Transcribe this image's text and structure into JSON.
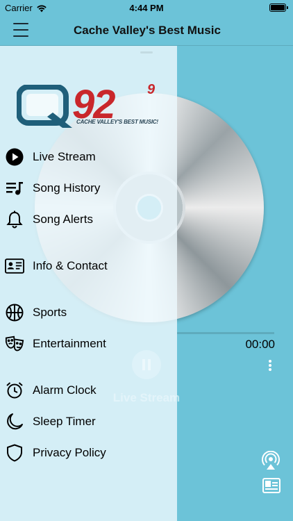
{
  "status_bar": {
    "carrier": "Carrier",
    "time": "4:44 PM"
  },
  "nav": {
    "title": "Cache Valley's Best Music"
  },
  "logo": {
    "brand": "Q92",
    "superscript": "9",
    "tagline": "CACHE VALLEY'S BEST MUSIC!"
  },
  "player": {
    "elapsed": "00:00",
    "stream_label": "Live Stream"
  },
  "menu": {
    "items": [
      {
        "label": "Live Stream",
        "icon": "play-circle-icon"
      },
      {
        "label": "Song History",
        "icon": "music-list-icon"
      },
      {
        "label": "Song Alerts",
        "icon": "bell-icon"
      },
      {
        "label": "Info & Contact",
        "icon": "contact-card-icon"
      },
      {
        "label": "Sports",
        "icon": "basketball-icon"
      },
      {
        "label": "Entertainment",
        "icon": "theater-masks-icon"
      },
      {
        "label": "Alarm Clock",
        "icon": "alarm-clock-icon"
      },
      {
        "label": "Sleep Timer",
        "icon": "moon-icon"
      },
      {
        "label": "Privacy Policy",
        "icon": "shield-icon"
      }
    ]
  },
  "colors": {
    "background": "#6cc3d8",
    "drawer": "#ebf8fc",
    "brand_red": "#c9272b",
    "brand_blue": "#1f5f7a"
  }
}
